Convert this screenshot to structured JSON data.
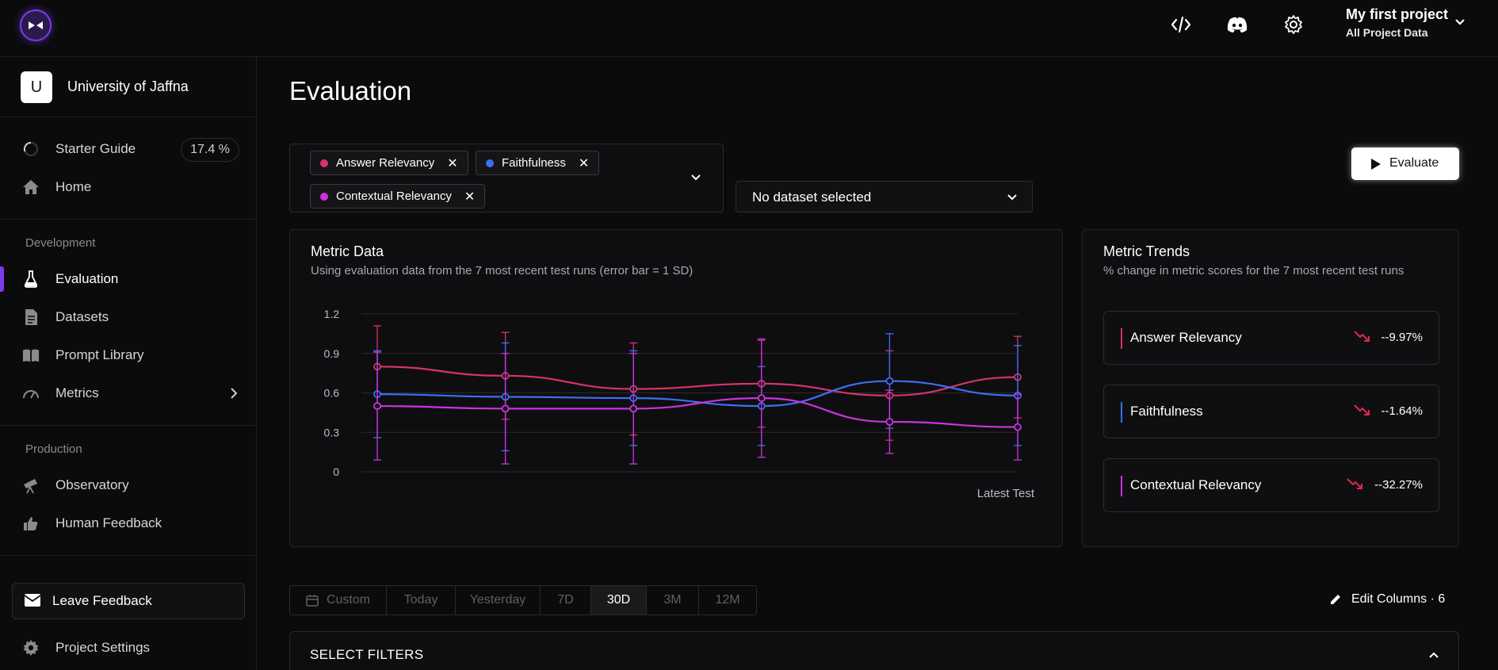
{
  "topbar": {
    "project_name": "My first project",
    "project_scope": "All Project Data",
    "icons": [
      "code-icon",
      "discord-icon",
      "gear-icon",
      "chevron-down-icon"
    ]
  },
  "sidebar": {
    "org_initial": "U",
    "org_name": "University of Jaffna",
    "starter_guide": {
      "label": "Starter Guide",
      "progress": "17.4 %"
    },
    "home_label": "Home",
    "development_label": "Development",
    "items_dev": [
      {
        "label": "Evaluation",
        "icon": "flask-icon"
      },
      {
        "label": "Datasets",
        "icon": "document-icon"
      },
      {
        "label": "Prompt Library",
        "icon": "book-icon"
      },
      {
        "label": "Metrics",
        "icon": "gauge-icon"
      }
    ],
    "production_label": "Production",
    "items_prod": [
      {
        "label": "Observatory",
        "icon": "telescope-icon"
      },
      {
        "label": "Human Feedback",
        "icon": "thumbs-icon"
      }
    ],
    "leave_feedback": "Leave Feedback",
    "project_settings": "Project Settings"
  },
  "main": {
    "title": "Evaluation",
    "metric_chips": [
      {
        "label": "Answer Relevancy",
        "color": "#d6336c"
      },
      {
        "label": "Faithfulness",
        "color": "#3b6ff5"
      },
      {
        "label": "Contextual Relevancy",
        "color": "#cc33dd"
      }
    ],
    "dataset_placeholder": "No dataset selected",
    "evaluate_label": "Evaluate",
    "metric_data": {
      "title": "Metric Data",
      "subtitle": "Using evaluation data from the 7 most recent test runs (error bar = 1 SD)",
      "x_label": "Latest Test"
    },
    "metric_trends": {
      "title": "Metric Trends",
      "subtitle": "% change in metric scores for the 7 most recent test runs",
      "rows": [
        {
          "name": "Answer Relevancy",
          "value": "--9.97%",
          "color": "#d6336c"
        },
        {
          "name": "Faithfulness",
          "value": "--1.64%",
          "color": "#3b6ff5"
        },
        {
          "name": "Contextual Relevancy",
          "value": "--32.27%",
          "color": "#cc33dd"
        }
      ]
    },
    "date_ranges": [
      "Custom",
      "Today",
      "Yesterday",
      "7D",
      "30D",
      "3M",
      "12M"
    ],
    "active_range": "30D",
    "edit_columns": "Edit Columns · 6",
    "select_filters": "SELECT FILTERS"
  },
  "chart_data": {
    "type": "line",
    "title": "",
    "xlabel": "Latest Test",
    "ylabel": "",
    "ylim": [
      0,
      1.2
    ],
    "yticks": [
      "0",
      "0.3",
      "0.6",
      "0.9",
      "1.2"
    ],
    "x": [
      1,
      2,
      3,
      4,
      5,
      6
    ],
    "grid": true,
    "series": [
      {
        "name": "Answer Relevancy",
        "color": "#d6336c",
        "values": [
          0.8,
          0.73,
          0.63,
          0.67,
          0.58,
          0.72
        ],
        "err": [
          0.31,
          0.33,
          0.35,
          0.33,
          0.34,
          0.31
        ]
      },
      {
        "name": "Faithfulness",
        "color": "#3b6ff5",
        "values": [
          0.59,
          0.57,
          0.56,
          0.5,
          0.69,
          0.58
        ],
        "err": [
          0.33,
          0.41,
          0.36,
          0.3,
          0.36,
          0.38
        ]
      },
      {
        "name": "Contextual Relevancy",
        "color": "#cc33dd",
        "values": [
          0.5,
          0.48,
          0.48,
          0.56,
          0.38,
          0.34
        ],
        "err": [
          0.41,
          0.42,
          0.42,
          0.45,
          0.24,
          0.25
        ]
      }
    ]
  }
}
